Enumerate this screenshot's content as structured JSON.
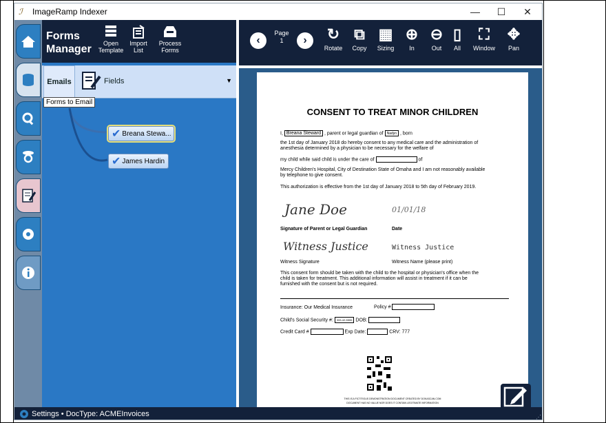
{
  "window": {
    "title": "ImageRamp Indexer",
    "minimize": "—",
    "maximize": "☐",
    "close": "✕"
  },
  "left": {
    "title_line1": "Forms",
    "title_line2": "Manager",
    "toolbar": [
      {
        "icon": "open-template-icon",
        "label1": "Open",
        "label2": "Template"
      },
      {
        "icon": "import-list-icon",
        "label1": "Import",
        "label2": "List"
      },
      {
        "icon": "process-forms-icon",
        "label1": "Process",
        "label2": "Forms"
      }
    ],
    "tabs": {
      "emails": "Emails",
      "fields": "Fields"
    },
    "tooltip": "Forms to Email",
    "nodes": [
      "Breana Stewa...",
      "James Hardin"
    ]
  },
  "viewer": {
    "page_label": "Page",
    "page_number": "1",
    "tools": [
      {
        "icon": "rotate-icon",
        "label": "Rotate"
      },
      {
        "icon": "copy-icon",
        "label": "Copy"
      },
      {
        "icon": "sizing-icon",
        "label": "Sizing"
      },
      {
        "icon": "zoom-in-icon",
        "label": "In"
      },
      {
        "icon": "zoom-out-icon",
        "label": "Out"
      },
      {
        "icon": "fit-all-icon",
        "label": "All"
      },
      {
        "icon": "window-icon",
        "label": "Window"
      },
      {
        "icon": "pan-icon",
        "label": "Pan"
      }
    ]
  },
  "document": {
    "title": "CONSENT TO TREAT MINOR CHILDREN",
    "l1a": "I,",
    "name": "Breana Steward",
    "l1b": ", parent or legal guardian of",
    "child": "Nadyn",
    "l1c": ", born",
    "l2": "the 1st day of January 2018 do hereby consent to any medical care and the administration of",
    "l3": "anesthesia determined by a physician to be necessary for the welfare of",
    "l4a": "my child while said child is under the care of",
    "l4b": "of",
    "l5": "Mercy Children's Hospital, City of Destination State of Omaha and I am not reasonably available",
    "l6": "by telephone to give consent.",
    "l7": "This authorization is effective from the 1st day of January 2018 to 5th day of February 2019.",
    "sig_parent": "Jane Doe",
    "sig_date": "01/01/18",
    "lbl_sig_parent": "Signature of Parent or Legal Guardian",
    "lbl_date": "Date",
    "sig_witness": "Witness Justice",
    "witness_name": "Witness Justice",
    "lbl_witness_sig": "Witness Signature",
    "lbl_witness_name": "Witness Name (please print)",
    "p2_1": "This consent form should be taken with the child to the hospital or physician's office when the",
    "p2_2": "child is taken for treatment. This additional information will assist in treatment if it can be",
    "p2_3": "furnished with the consent but is not required.",
    "insurance": "Insurance: Our Medical Insurance",
    "policy": "Policy #",
    "ssn_label": "Child's Social Security #:",
    "ssn_value": "333-42-5555",
    "dob_label": "DOB:",
    "cc_label": "Credit Card #",
    "exp_label": "Exp Date:",
    "crv": "CRV: 777",
    "footer1": "THIS IS A FICTITIOUS DEMONSTRATION DOCUMENT CREATED BY DOKASCAN.COM",
    "footer2": "DOCUMENT HAS NO VALUE NOR DOES IT CONTAIN LEGITIMATE INFORMATION"
  },
  "status": {
    "text": "Settings • DocType: ACMEInvoices"
  }
}
